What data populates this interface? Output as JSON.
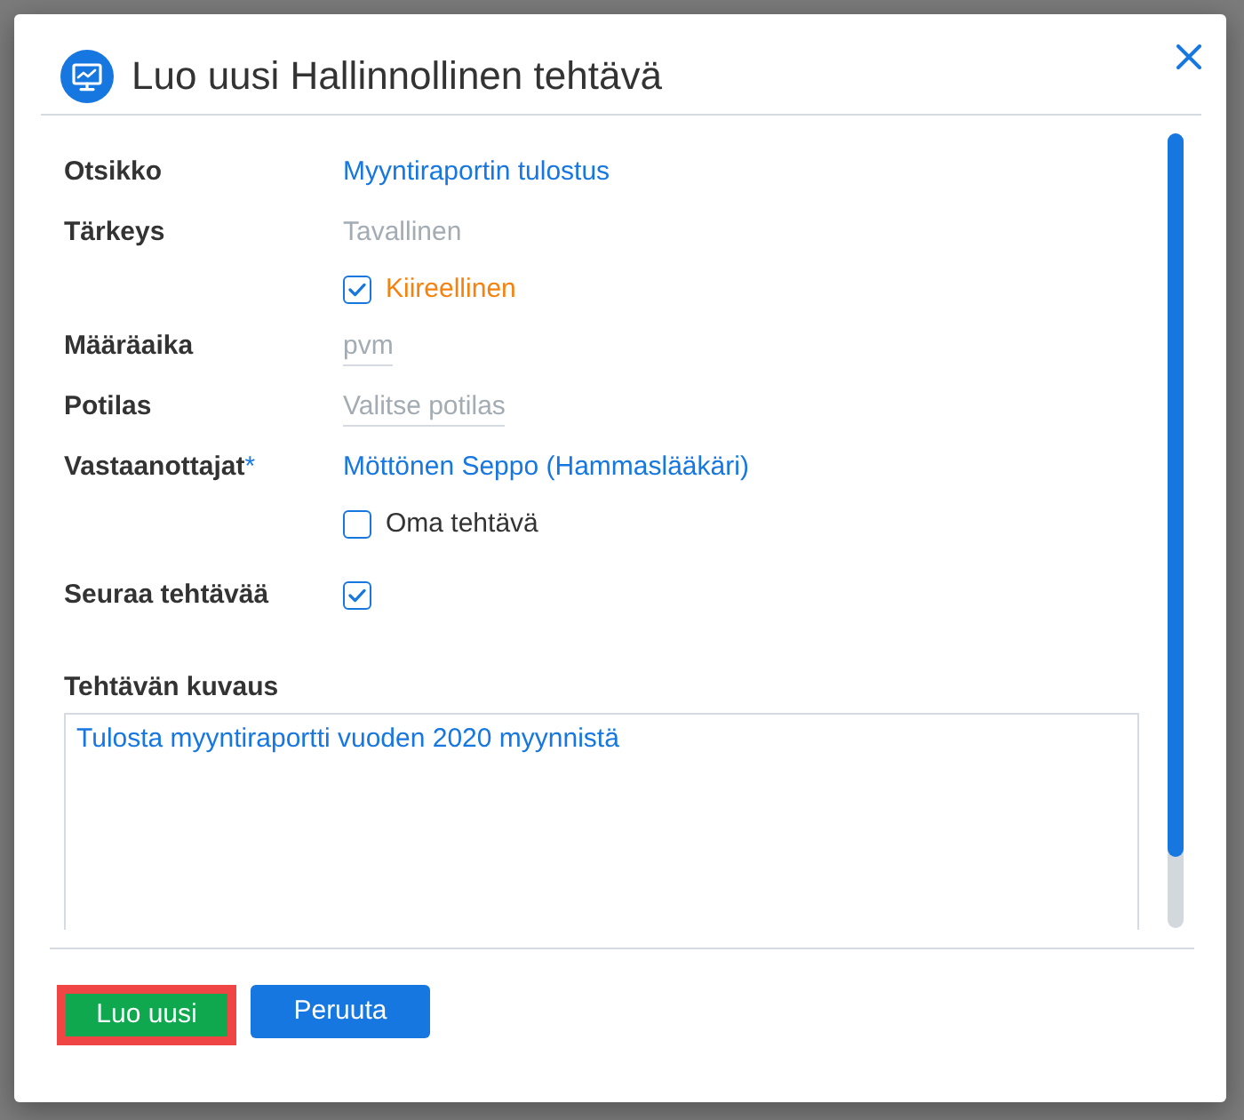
{
  "dialog": {
    "title": "Luo uusi Hallinnollinen tehtävä"
  },
  "fields": [
    {
      "kind": "link",
      "label": "Otsikko",
      "value": "Myyntiraportin tulostus"
    },
    {
      "kind": "text",
      "label": "Tärkeys",
      "value": "Tavallinen",
      "option": {
        "label": "Kiireellinen",
        "checked": true
      }
    },
    {
      "kind": "input",
      "label": "Määräaika",
      "placeholder": "pvm"
    },
    {
      "kind": "input",
      "label": "Potilas",
      "placeholder": "Valitse potilas"
    },
    {
      "kind": "link",
      "label": "Vastaanottajat",
      "required_mark": "*",
      "value": "Möttönen Seppo (Hammaslääkäri)",
      "option": {
        "label": "Oma tehtävä",
        "checked": false
      }
    },
    {
      "kind": "checkbox",
      "label": "Seuraa tehtävää",
      "checked": true
    }
  ],
  "description": {
    "label": "Tehtävän kuvaus",
    "value": "Tulosta myyntiraportti vuoden 2020 myynnistä"
  },
  "buttons": [
    {
      "kind": "primary",
      "label": "Luo uusi",
      "highlighted": true
    },
    {
      "kind": "secondary",
      "label": "Peruuta",
      "highlighted": false
    }
  ]
}
